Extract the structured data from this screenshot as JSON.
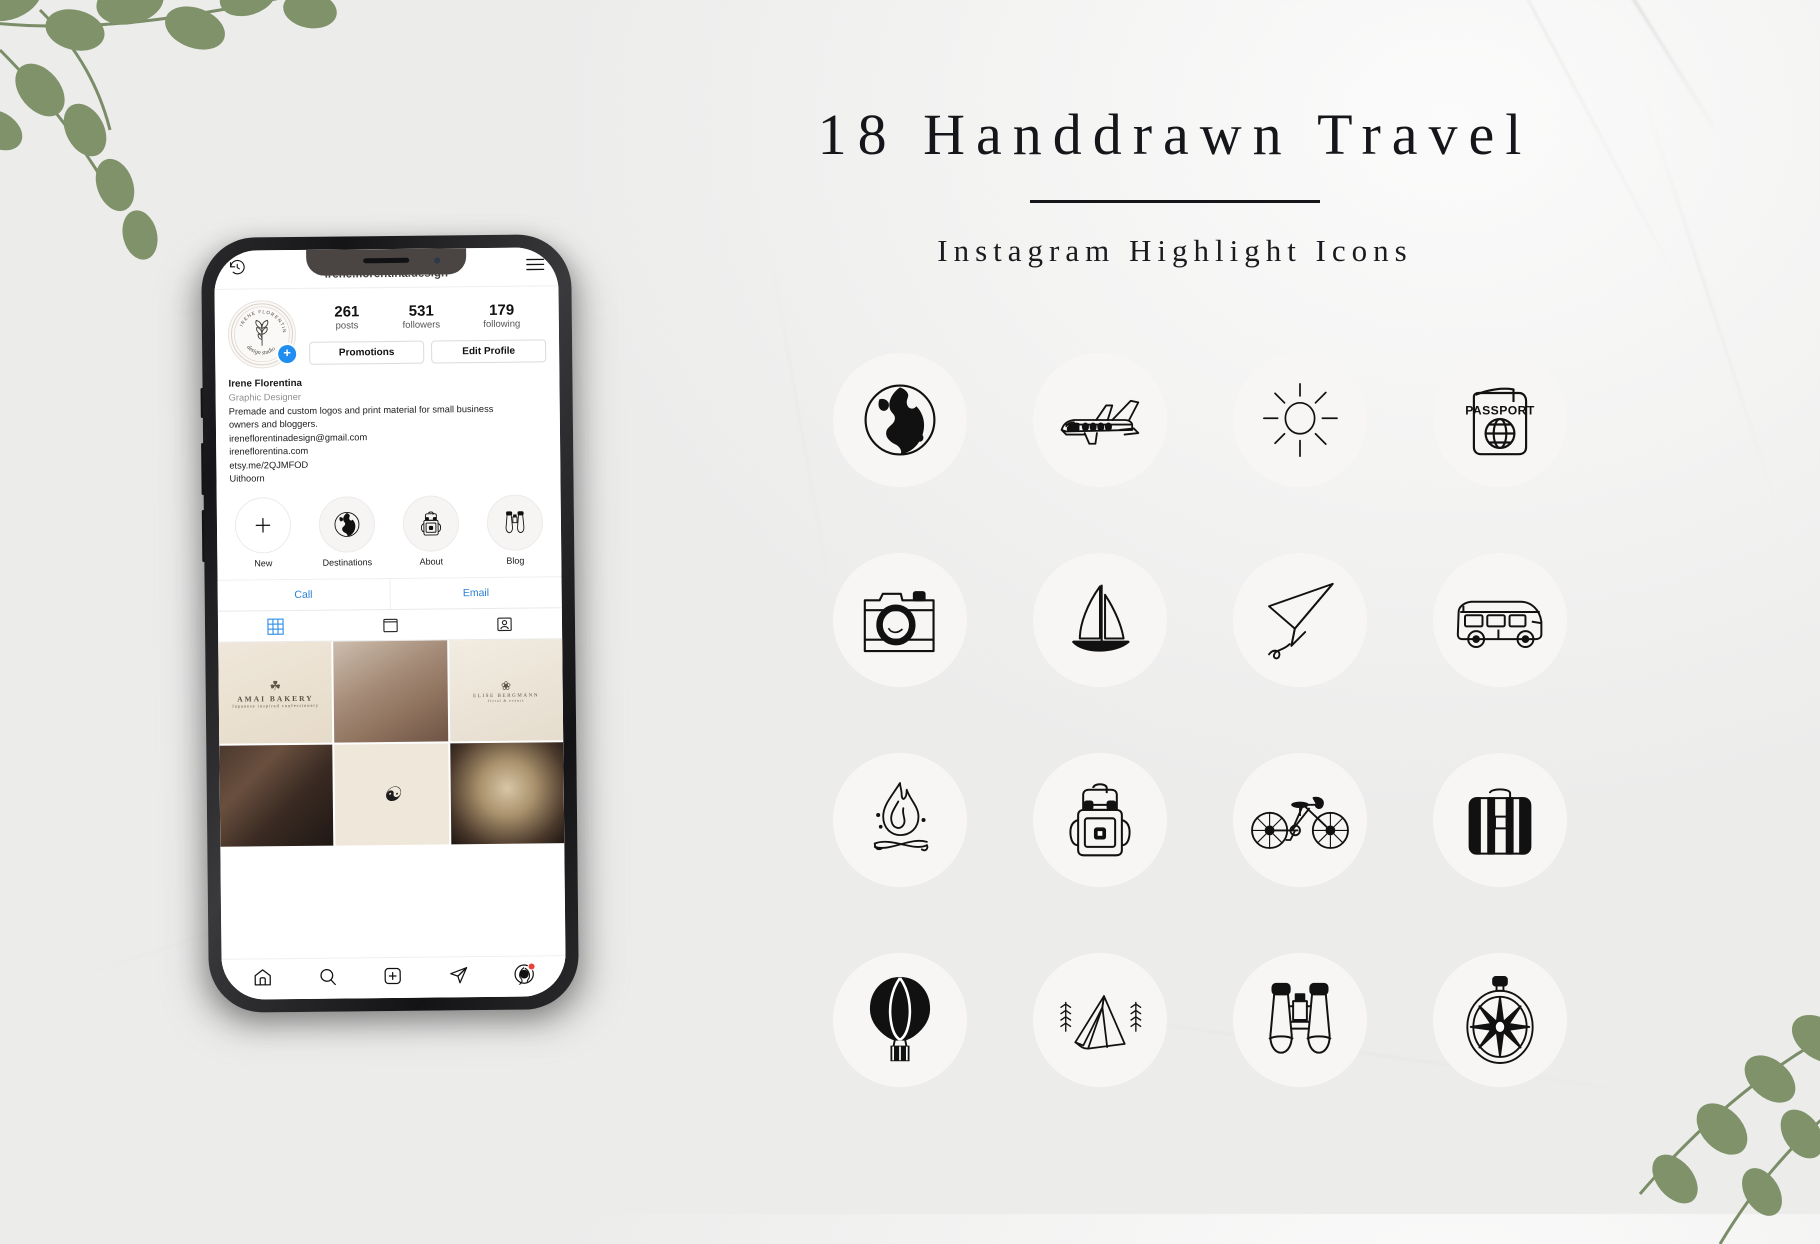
{
  "header": {
    "title": "18 Handdrawn Travel",
    "subtitle": "Instagram Highlight Icons"
  },
  "colors": {
    "background": "#f1f1f0",
    "bubble": "#f8f6f5",
    "ink": "#15161a",
    "ig_link_blue": "#2a7fd4",
    "ig_badge_blue": "#1f8ef0"
  },
  "icons": [
    {
      "name": "globe-icon",
      "label": "Globe"
    },
    {
      "name": "airplane-icon",
      "label": "Airplane"
    },
    {
      "name": "sun-icon",
      "label": "Sun"
    },
    {
      "name": "passport-icon",
      "label": "Passport",
      "text": "PASSPORT"
    },
    {
      "name": "camera-icon",
      "label": "Camera"
    },
    {
      "name": "sailboat-icon",
      "label": "Sailboat"
    },
    {
      "name": "paper-plane-icon",
      "label": "Paper Plane"
    },
    {
      "name": "van-icon",
      "label": "Van"
    },
    {
      "name": "campfire-icon",
      "label": "Campfire"
    },
    {
      "name": "backpack-icon",
      "label": "Backpack"
    },
    {
      "name": "bicycle-icon",
      "label": "Bicycle"
    },
    {
      "name": "suitcase-icon",
      "label": "Suitcase"
    },
    {
      "name": "hot-air-balloon-icon",
      "label": "Hot Air Balloon"
    },
    {
      "name": "tent-icon",
      "label": "Tent"
    },
    {
      "name": "binoculars-icon",
      "label": "Binoculars"
    },
    {
      "name": "compass-icon",
      "label": "Compass"
    }
  ],
  "phone": {
    "instagram": {
      "topbar": {
        "back_icon": "clock-history-icon",
        "username": "irene.florentina.design",
        "menu_icon": "hamburger-menu-icon"
      },
      "avatar": {
        "ring_top_text": "IRENE FLORENTINA",
        "ring_bottom_text": "design studio",
        "add_badge": "+"
      },
      "stats": [
        {
          "value": "261",
          "label": "posts"
        },
        {
          "value": "531",
          "label": "followers"
        },
        {
          "value": "179",
          "label": "following"
        }
      ],
      "buttons": [
        {
          "label": "Promotions"
        },
        {
          "label": "Edit Profile"
        }
      ],
      "bio": {
        "name": "Irene Florentina",
        "category": "Graphic Designer",
        "line1": "Premade and custom logos and print material for small business",
        "line2": "owners and bloggers.",
        "email": "ireneflorentinadesign@gmail.com",
        "website": "ireneflorentina.com",
        "shop": "etsy.me/2QJMFOD",
        "location": "Uithoorn"
      },
      "highlights": [
        {
          "label": "New",
          "icon": "plus-icon"
        },
        {
          "label": "Destinations",
          "icon": "globe-icon"
        },
        {
          "label": "About",
          "icon": "backpack-icon"
        },
        {
          "label": "Blog",
          "icon": "binoculars-icon"
        }
      ],
      "contact": [
        {
          "label": "Call"
        },
        {
          "label": "Email"
        }
      ],
      "tabs": [
        {
          "icon": "grid-tab-icon",
          "active": true
        },
        {
          "icon": "reels-tab-icon",
          "active": false
        },
        {
          "icon": "tagged-tab-icon",
          "active": false
        }
      ],
      "bottom_nav": [
        {
          "icon": "home-icon"
        },
        {
          "icon": "search-icon"
        },
        {
          "icon": "add-post-icon"
        },
        {
          "icon": "direct-share-icon"
        },
        {
          "icon": "profile-avatar-icon",
          "badge": true
        }
      ]
    }
  }
}
